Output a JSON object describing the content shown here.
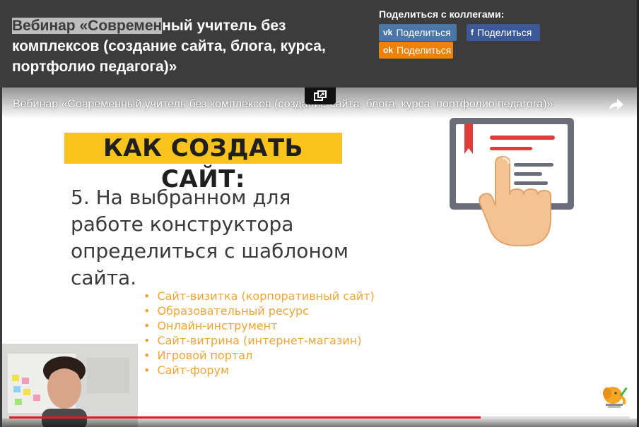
{
  "header": {
    "title_highlight": "Вебинар «Современ",
    "title_rest": "ный учитель без комплексов (создание сайта, блога, курса, портфолио педагога)»"
  },
  "share": {
    "heading": "Поделиться с коллегами:",
    "vk": {
      "icon": "vk-icon",
      "glyph": "vk",
      "label": "Поделиться",
      "color": "#4a76a8"
    },
    "fb": {
      "icon": "facebook-icon",
      "glyph": "f",
      "label": "Поделиться",
      "color": "#3b5998"
    },
    "ok": {
      "icon": "odnoklassniki-icon",
      "glyph": "ok",
      "label": "Поделиться",
      "color": "#ee8208"
    }
  },
  "video": {
    "title": "Вебинар «Современный учитель без комплексов (создание сайта, блога, курса, портфолио педагога)»",
    "progress": 0.76,
    "progress_color": "#e21c1c"
  },
  "slide": {
    "heading": "КАК СОЗДАТЬ САЙТ:",
    "heading_color": "#f7c31c",
    "text": "5. На выбранном для работе конструктора определиться с шаблоном сайта.",
    "list_color": "#f2a534",
    "items": [
      "Сайт-визитка (корпоративный сайт)",
      "Образовательный ресурс",
      "Онлайн-инструмент",
      "Сайт-витрина (интернет-магазин)",
      "Игровой портал",
      "Сайт-форум"
    ]
  }
}
